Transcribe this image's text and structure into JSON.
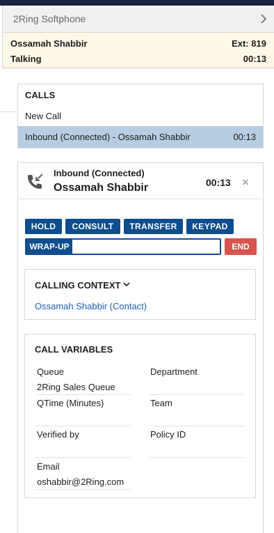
{
  "app": {
    "title": "2Ring Softphone"
  },
  "status": {
    "agent_name": "Ossamah Shabbir",
    "state": "Talking",
    "extension": "Ext: 819",
    "timer": "00:13"
  },
  "calls": {
    "title": "CALLS",
    "new_call": "New Call",
    "active_call": {
      "label": "Inbound (Connected) - Ossamah Shabbir",
      "time": "00:13"
    }
  },
  "call": {
    "direction": "Inbound (Connected)",
    "caller": "Ossamah Shabbir",
    "timer": "00:13",
    "close": "×",
    "buttons": {
      "hold": "HOLD",
      "consult": "CONSULT",
      "transfer": "TRANSFER",
      "keypad": "KEYPAD",
      "end": "END"
    },
    "wrapup": {
      "label": "WRAP-UP",
      "value": ""
    }
  },
  "context": {
    "title": "CALLING CONTEXT",
    "link": "Ossamah Shabbir (Contact)"
  },
  "variables": {
    "title": "CALL VARIABLES",
    "items": [
      {
        "label": "Queue",
        "value": "2Ring Sales Queue"
      },
      {
        "label": "Department",
        "value": ""
      },
      {
        "label": "QTime (Minutes)",
        "value": ""
      },
      {
        "label": "Team",
        "value": ""
      },
      {
        "label": "Verified by",
        "value": ""
      },
      {
        "label": "Policy ID",
        "value": ""
      },
      {
        "label": "Email",
        "value": "oshabbir@2Ring.com"
      }
    ]
  },
  "colors": {
    "accent": "#0f4d8f",
    "end_button": "#d9534f",
    "selected_row": "#b7cde2",
    "status_bg": "#fff7e8",
    "link": "#1f5fb5"
  },
  "icons": [
    "chevron-right-icon",
    "incoming-call-phone-icon",
    "close-icon",
    "chevron-down-icon"
  ]
}
